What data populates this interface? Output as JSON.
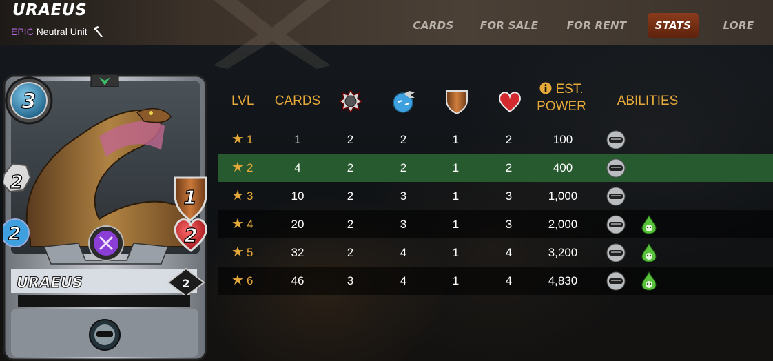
{
  "header": {
    "title": "URAEUS",
    "rarity": "EPIC",
    "unit_type": "Neutral Unit",
    "unit_icon": "melee-attack-icon"
  },
  "nav": {
    "tabs": [
      {
        "label": "CARDS",
        "active": false
      },
      {
        "label": "FOR SALE",
        "active": false
      },
      {
        "label": "FOR RENT",
        "active": false
      },
      {
        "label": "STATS",
        "active": true
      },
      {
        "label": "LORE",
        "active": false
      }
    ]
  },
  "card": {
    "name": "URAEUS",
    "mana": "3",
    "melee": "2",
    "speed": "2",
    "armor": "1",
    "health": "2",
    "level": "2",
    "element_icon": "neutral-element-icon",
    "ability_icon": "blind-icon"
  },
  "table": {
    "headers": {
      "lvl": "LVL",
      "cards": "CARDS",
      "melee_icon": "melee-attack-icon",
      "speed_icon": "speed-icon",
      "armor_icon": "armor-shield-icon",
      "health_icon": "health-heart-icon",
      "info_icon": "info-icon",
      "est_power_1": "EST.",
      "est_power_2": "POWER",
      "abilities": "ABILITIES"
    },
    "rows": [
      {
        "lvl": "1",
        "cards": "1",
        "melee": "2",
        "speed": "2",
        "armor": "1",
        "health": "2",
        "power": "100",
        "abilities": [
          "blind-icon"
        ]
      },
      {
        "lvl": "2",
        "cards": "4",
        "melee": "2",
        "speed": "2",
        "armor": "1",
        "health": "2",
        "power": "400",
        "abilities": [
          "blind-icon"
        ]
      },
      {
        "lvl": "3",
        "cards": "10",
        "melee": "2",
        "speed": "3",
        "armor": "1",
        "health": "3",
        "power": "1,000",
        "abilities": [
          "blind-icon"
        ]
      },
      {
        "lvl": "4",
        "cards": "20",
        "melee": "2",
        "speed": "3",
        "armor": "1",
        "health": "3",
        "power": "2,000",
        "abilities": [
          "blind-icon",
          "poison-icon"
        ]
      },
      {
        "lvl": "5",
        "cards": "32",
        "melee": "2",
        "speed": "4",
        "armor": "1",
        "health": "4",
        "power": "3,200",
        "abilities": [
          "blind-icon",
          "poison-icon"
        ]
      },
      {
        "lvl": "6",
        "cards": "46",
        "melee": "3",
        "speed": "4",
        "armor": "1",
        "health": "4",
        "power": "4,830",
        "abilities": [
          "blind-icon",
          "poison-icon"
        ]
      }
    ],
    "highlight_row": 1
  },
  "colors": {
    "accent": "#e5a93a",
    "epic": "#b467e0",
    "active_tab": "#7a3116",
    "highlight_row": "#275a2f"
  }
}
